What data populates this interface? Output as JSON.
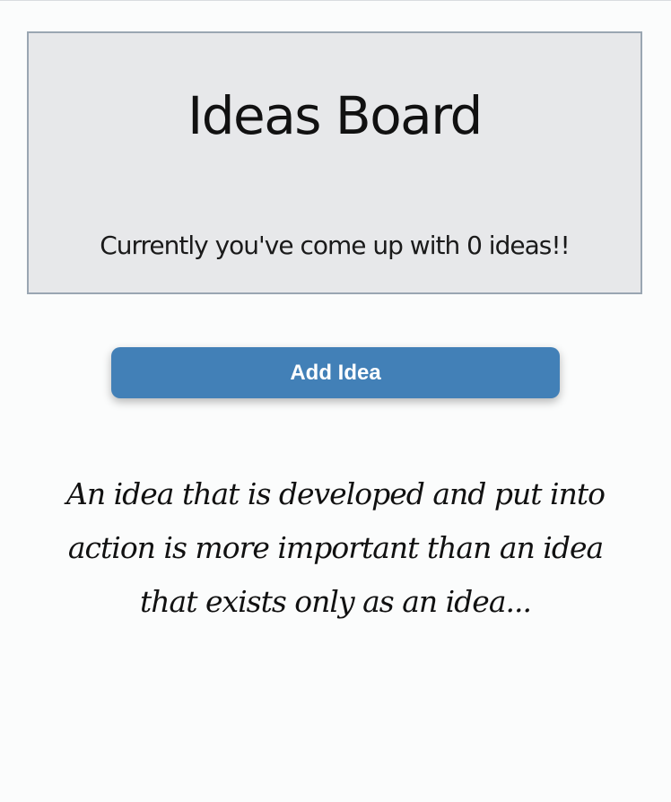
{
  "header": {
    "title": "Ideas Board",
    "idea_count_text": "Currently you've come up with 0 ideas!!"
  },
  "actions": {
    "add_idea_label": "Add Idea"
  },
  "quote": {
    "text": "An idea that is developed and put into action is more important than an idea that exists only as an idea..."
  },
  "colors": {
    "background": "#fbfcfc",
    "header_bg": "#e7e8ea",
    "header_border": "#9aa6b2",
    "button_bg": "#4280b7",
    "button_text": "#ffffff"
  }
}
